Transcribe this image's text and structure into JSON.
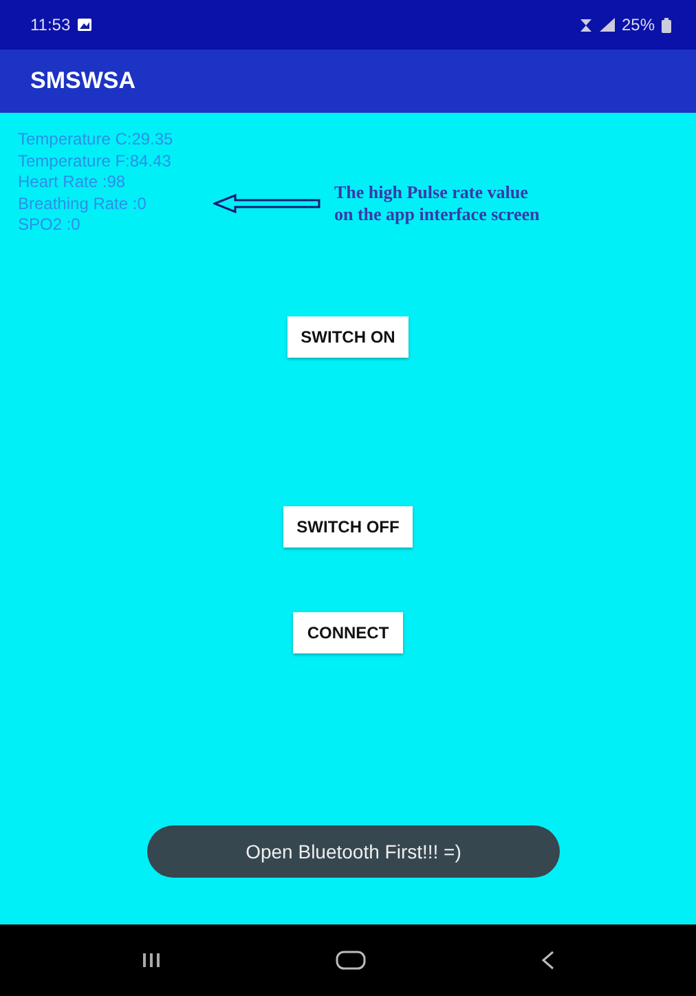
{
  "status_bar": {
    "time": "11:53",
    "battery": "25%"
  },
  "app_bar": {
    "title": "SMSWSA"
  },
  "readings": [
    "Temperature C:29.35",
    "Temperature F:84.43",
    "Heart Rate :98",
    "Breathing Rate :0",
    "SPO2 :0"
  ],
  "annotation": {
    "lines": [
      "The high Pulse rate value",
      "on the app interface screen"
    ]
  },
  "buttons": [
    "SWITCH ON",
    "SWITCH OFF",
    "CONNECT"
  ],
  "toast": {
    "text": "Open Bluetooth First!!! =)"
  }
}
